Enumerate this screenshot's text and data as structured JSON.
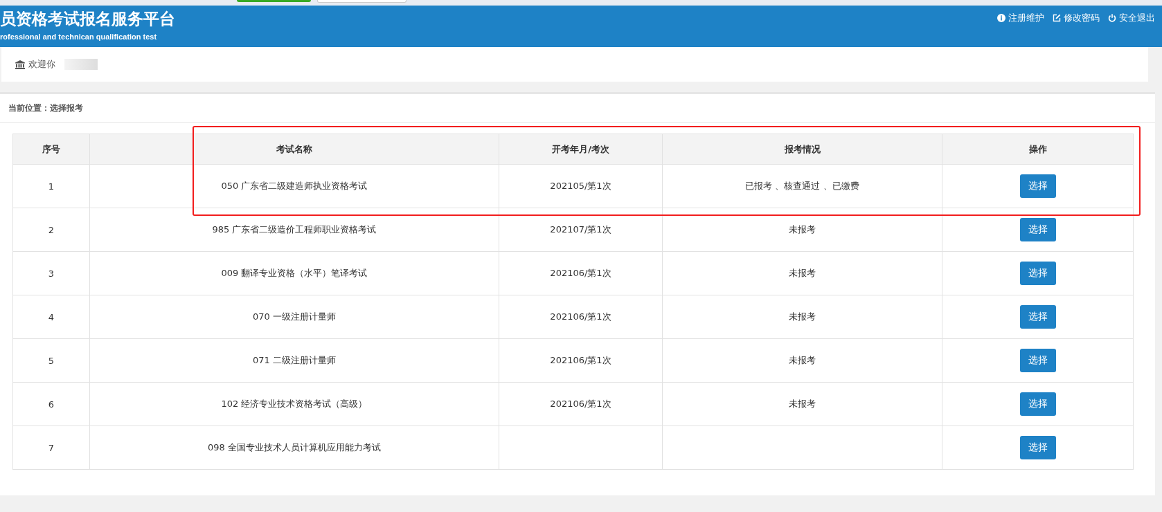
{
  "header": {
    "title": "员资格考试报名服务平台",
    "subtitle": "rofessional and technican qualification test",
    "links": [
      {
        "kind": "info",
        "label": "注册维护"
      },
      {
        "kind": "edit",
        "label": "修改密码"
      },
      {
        "kind": "power",
        "label": "安全退出"
      }
    ]
  },
  "welcome": {
    "label": "欢迎你"
  },
  "breadcrumb": "当前位置：选择报考",
  "table": {
    "columns": [
      "序号",
      "考试名称",
      "开考年月/考次",
      "报考情况",
      "操作"
    ],
    "rows": [
      {
        "no": "1",
        "name": "050 广东省二级建造师执业资格考试",
        "date": "202105/第1次",
        "status": "已报考 、核查通过 、已缴费",
        "action": "选择"
      },
      {
        "no": "2",
        "name": "985 广东省二级造价工程师职业资格考试",
        "date": "202107/第1次",
        "status": "未报考",
        "action": "选择"
      },
      {
        "no": "3",
        "name": "009 翻译专业资格（水平）笔译考试",
        "date": "202106/第1次",
        "status": "未报考",
        "action": "选择"
      },
      {
        "no": "4",
        "name": "070 一级注册计量师",
        "date": "202106/第1次",
        "status": "未报考",
        "action": "选择"
      },
      {
        "no": "5",
        "name": "071 二级注册计量师",
        "date": "202106/第1次",
        "status": "未报考",
        "action": "选择"
      },
      {
        "no": "6",
        "name": "102 经济专业技术资格考试（高级）",
        "date": "202106/第1次",
        "status": "未报考",
        "action": "选择"
      },
      {
        "no": "7",
        "name": "098 全国专业技术人员计算机应用能力考试",
        "date": "",
        "status": "",
        "action": "选择"
      }
    ]
  }
}
